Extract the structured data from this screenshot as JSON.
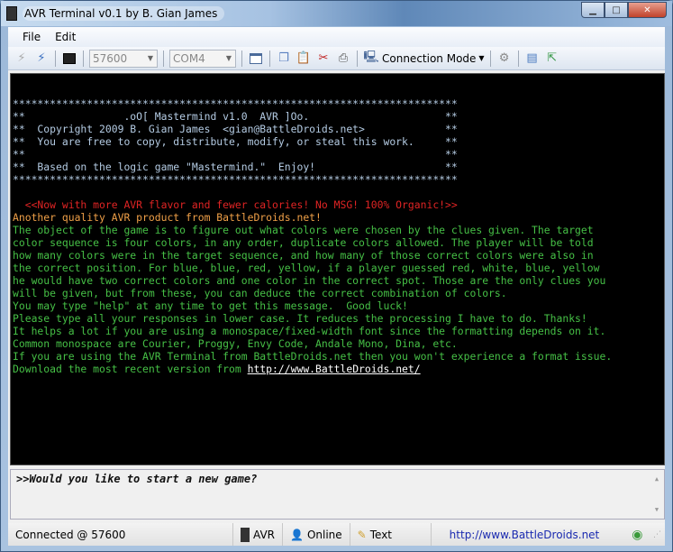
{
  "window": {
    "title": "AVR Terminal v0.1 by B. Gian James"
  },
  "menu": [
    "File",
    "Edit"
  ],
  "toolbar": {
    "baud": "57600",
    "port": "COM4",
    "connection_mode": "Connection Mode"
  },
  "terminal": {
    "header": [
      "************************************************************************",
      "**                .oO[ Mastermind v1.0  AVR ]Oo.                      **",
      "**  Copyright 2009 B. Gian James  <gian@BattleDroids.net>             **",
      "**  You are free to copy, distribute, modify, or steal this work.     **",
      "**                                                                    **",
      "**  Based on the logic game \"Mastermind.\"  Enjoy!                     **",
      "************************************************************************"
    ],
    "promo": "  <<Now with more AVR flavor and fewer calories! No MSG! 100% Organic!>>",
    "tagline": "Another quality AVR product from BattleDroids.net!",
    "body": [
      "The object of the game is to figure out what colors were chosen by the clues given. The target",
      "color sequence is four colors, in any order, duplicate colors allowed. The player will be told",
      "how many colors were in the target sequence, and how many of those correct colors were also in",
      "the correct position. For blue, blue, red, yellow, if a player guessed red, white, blue, yellow",
      "he would have two correct colors and one color in the correct spot. Those are the only clues you",
      "will be given, but from these, you can deduce the correct combination of colors.",
      "You may type \"help\" at any time to get this message.  Good luck!",
      "Please type all your responses in lower case. It reduces the processing I have to do. Thanks!",
      "It helps a lot if you are using a monospace/fixed-width font since the formatting depends on it.",
      "Common monospace are Courier, Proggy, Envy Code, Andale Mono, Dina, etc.",
      "If you are using the AVR Terminal from BattleDroids.net then you won't experience a format issue."
    ],
    "download_prefix": "Download the most recent version from ",
    "download_link": "http://www.BattleDroids.net/"
  },
  "input": {
    "text": ">>Would you like to start a new game?"
  },
  "status": {
    "connection": "Connected @ 57600",
    "device": "AVR",
    "presence": "Online",
    "mode": "Text",
    "link": "http://www.BattleDroids.net"
  },
  "colors": {
    "header": "#b4cbe3",
    "promo": "#e02424",
    "tagline": "#f0a048",
    "body": "#46c046"
  }
}
